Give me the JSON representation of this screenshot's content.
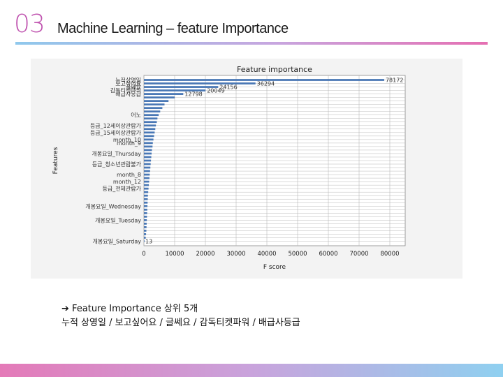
{
  "slide": {
    "number": "03",
    "title": "Machine Learning – feature Importance"
  },
  "caption": {
    "arrow": "➔",
    "line1": "Feature Importance 상위 5개",
    "line2": "누적 상영일 / 보고싶어요 / 글쎄요 / 감독티켓파워 / 배급사등급"
  },
  "colors": {
    "accent": "#c055b0",
    "bar": "#4a78b5",
    "grid": "#b8b8b8",
    "plot_bg": "#ffffff",
    "frame_bg": "#f3f3f3"
  },
  "chart_data": {
    "type": "bar",
    "orientation": "horizontal",
    "title": "Feature importance",
    "xlabel": "F score",
    "ylabel": "Features",
    "xlim": [
      0,
      85000
    ],
    "xticks": [
      0,
      10000,
      20000,
      30000,
      40000,
      50000,
      60000,
      70000,
      80000
    ],
    "grid": true,
    "categories_top_to_bottom": [
      "누적상영일",
      "보고싶어요",
      "글쎄요",
      "감독티켓파워",
      "배급사등급",
      "",
      "",
      "",
      "",
      "",
      "어노",
      "",
      "",
      "등급_12세이상관람가",
      "",
      "등급_15세이상관람가",
      "",
      "month_10",
      "month_9",
      "",
      "",
      "개봉요일_Thursday",
      "",
      "",
      "등급_청소년관람불가",
      "",
      "",
      "month_8",
      "",
      "month_12",
      "",
      "등급_전체관람가",
      "",
      "",
      "",
      "",
      "개봉요일_Wednesday",
      "",
      "",
      "",
      "개봉요일_Tuesday",
      "",
      "",
      "",
      "",
      "",
      "개봉요일_Saturday"
    ],
    "values_top_to_bottom": [
      78172,
      36294,
      24156,
      20049,
      12798,
      10000,
      8000,
      6700,
      6000,
      5300,
      4800,
      4400,
      4200,
      3900,
      3700,
      3500,
      3300,
      3100,
      2900,
      2800,
      2600,
      2500,
      2400,
      2300,
      2200,
      2100,
      2000,
      1900,
      1800,
      1700,
      1600,
      1500,
      1400,
      1300,
      1250,
      1200,
      1150,
      1100,
      1050,
      1000,
      950,
      900,
      850,
      800,
      700,
      600,
      13
    ],
    "value_labels_top_to_bottom": [
      "78172",
      "36294",
      "24156",
      "20049",
      "12798",
      "",
      "",
      "",
      "",
      "",
      "",
      "",
      "",
      "",
      "",
      "",
      "",
      "",
      "",
      "",
      "",
      "",
      "",
      "",
      "",
      "",
      "",
      "",
      "",
      "",
      "",
      "",
      "",
      "",
      "",
      "",
      "",
      "",
      "",
      "",
      "",
      "",
      "",
      "",
      "",
      "",
      "13"
    ]
  }
}
